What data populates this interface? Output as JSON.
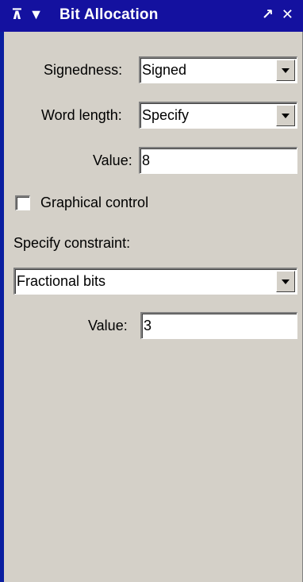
{
  "titlebar": {
    "title": "Bit Allocation",
    "left_icons": [
      "pin-up-icon",
      "collapse-triangle-icon"
    ],
    "undock_glyph": "↗",
    "close_glyph": "✕",
    "pin_glyph": "⊼",
    "menu_glyph": "▼"
  },
  "signedness": {
    "label": "Signedness:",
    "value": "Signed"
  },
  "word_length": {
    "label": "Word length:",
    "value": "Specify"
  },
  "word_length_value": {
    "label": "Value:",
    "value": "8"
  },
  "graphical_control": {
    "label": "Graphical control",
    "checked": false
  },
  "constraint": {
    "heading": "Specify constraint:",
    "value": "Fractional bits"
  },
  "constraint_value": {
    "label": "Value:",
    "value": "3"
  },
  "colors": {
    "titlebar": "#14119f",
    "panel": "#d4d0c8",
    "left_edge": "#0a1ea0"
  }
}
